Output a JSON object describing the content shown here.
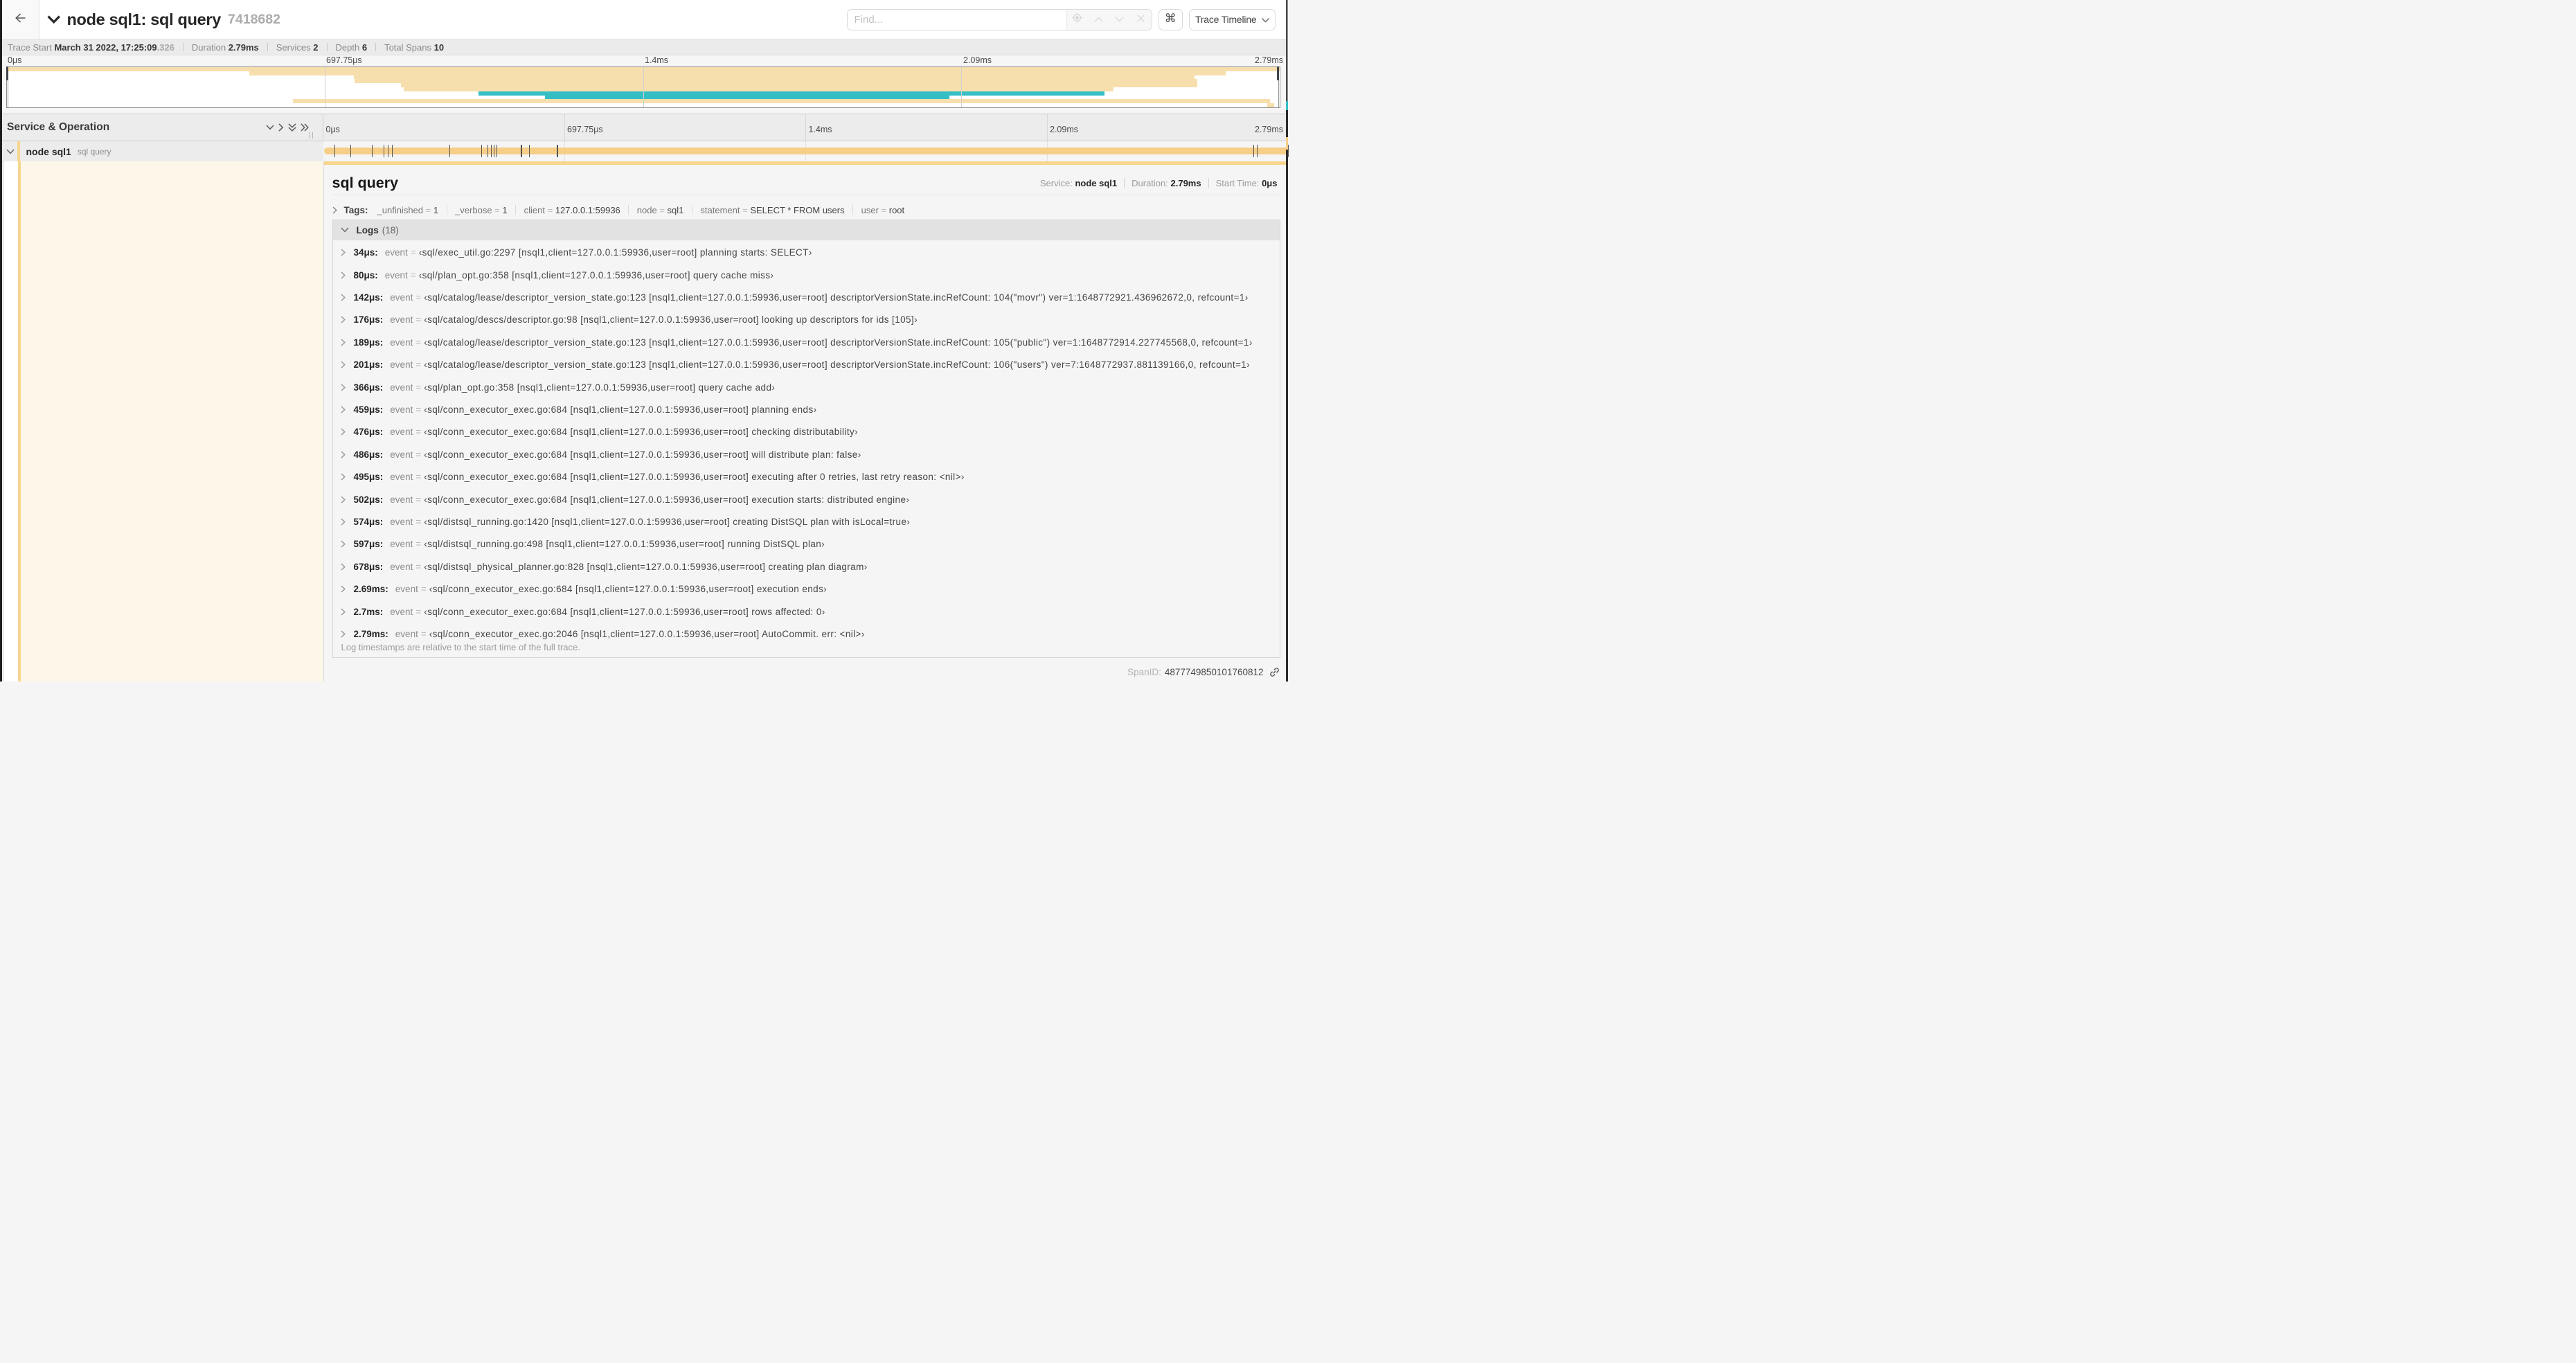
{
  "colors": {
    "tan_minimap": "#f7dfad",
    "teal_minimap": "#35bfc5",
    "tan_bar": "#f6ce87",
    "tan_strip": "#f6d68e",
    "cream": "#fdf7ea",
    "marker": "#555555"
  },
  "header": {
    "back_icon": "left-arrow",
    "collapse_icon": "chevron-down",
    "title": "node sql1: sql query",
    "trace_id": "7418682",
    "find_placeholder": "Find...",
    "find_icons": [
      "scope-icon",
      "chevron-up-icon",
      "chevron-down-icon",
      "clear-x-icon"
    ],
    "cmd_button": "⌘",
    "view_button": "Trace Timeline"
  },
  "summary": {
    "items": [
      {
        "label": "Trace Start",
        "value": "March 31 2022, 17:25:09",
        "sub": ".326"
      },
      {
        "label": "Duration",
        "value": "2.79ms"
      },
      {
        "label": "Services",
        "value": "2"
      },
      {
        "label": "Depth",
        "value": "6"
      },
      {
        "label": "Total Spans",
        "value": "10"
      }
    ]
  },
  "ruler": {
    "ticks": [
      {
        "label": "0μs",
        "pos": 0
      },
      {
        "label": "697.75μs",
        "pos": 0.25
      },
      {
        "label": "1.4ms",
        "pos": 0.5
      },
      {
        "label": "2.09ms",
        "pos": 0.75
      },
      {
        "label": "2.79ms",
        "pos": 1
      }
    ]
  },
  "minimap": {
    "spans": [
      {
        "start": 0,
        "end": 1,
        "color": "tan_minimap"
      },
      {
        "start": 0.1903,
        "end": 0.9578,
        "color": "tan_minimap"
      },
      {
        "start": 0.2724,
        "end": 0.9333,
        "color": "tan_minimap"
      },
      {
        "start": 0.2732,
        "end": 0.935,
        "color": "tan_minimap"
      },
      {
        "start": 0.3094,
        "end": 0.935,
        "color": "tan_minimap"
      },
      {
        "start": 0.3118,
        "end": 0.8694,
        "color": "tan_minimap"
      },
      {
        "start": 0.3703,
        "end": 0.8626,
        "color": "teal_minimap"
      },
      {
        "start": 0.4225,
        "end": 0.7403,
        "color": "teal_minimap"
      },
      {
        "start": 0.2248,
        "end": 0.9923,
        "color": "tan_minimap"
      },
      {
        "start": 0.9902,
        "end": 0.9956,
        "color": "tan_minimap"
      }
    ]
  },
  "timeline": {
    "column_title": "Service & Operation",
    "icons": [
      "chevron-down-icon",
      "chevron-right-icon",
      "double-chevron-down-icon",
      "double-chevron-right-icon"
    ]
  },
  "span_row": {
    "service": "node sql1",
    "operation": "sql query",
    "duration_us": 2790,
    "marker_times_us": [
      34,
      80,
      142,
      176,
      189,
      201,
      366,
      459,
      476,
      486,
      495,
      502,
      574,
      597,
      678,
      2690,
      2700,
      2790
    ]
  },
  "detail": {
    "title": "sql query",
    "meta": [
      {
        "label": "Service:",
        "value": "node sql1"
      },
      {
        "label": "Duration:",
        "value": "2.79ms"
      },
      {
        "label": "Start Time:",
        "value": "0μs"
      }
    ],
    "tags_label": "Tags:",
    "tags": [
      {
        "key": "_unfinished",
        "value": "1"
      },
      {
        "key": "_verbose",
        "value": "1"
      },
      {
        "key": "client",
        "value": "127.0.0.1:59936"
      },
      {
        "key": "node",
        "value": "sql1"
      },
      {
        "key": "statement",
        "value": "SELECT * FROM users"
      },
      {
        "key": "user",
        "value": "root"
      }
    ],
    "logs_label": "Logs",
    "logs_count": "(18)",
    "log_field": "event",
    "logs": [
      {
        "time": "34μs:",
        "value": "‹sql/exec_util.go:2297 [nsql1,client=127.0.0.1:59936,user=root] planning starts: SELECT›"
      },
      {
        "time": "80μs:",
        "value": "‹sql/plan_opt.go:358 [nsql1,client=127.0.0.1:59936,user=root] query cache miss›"
      },
      {
        "time": "142μs:",
        "value": "‹sql/catalog/lease/descriptor_version_state.go:123 [nsql1,client=127.0.0.1:59936,user=root] descriptorVersionState.incRefCount: 104(\"movr\") ver=1:1648772921.436962672,0, refcount=1›"
      },
      {
        "time": "176μs:",
        "value": "‹sql/catalog/descs/descriptor.go:98 [nsql1,client=127.0.0.1:59936,user=root] looking up descriptors for ids [105]›"
      },
      {
        "time": "189μs:",
        "value": "‹sql/catalog/lease/descriptor_version_state.go:123 [nsql1,client=127.0.0.1:59936,user=root] descriptorVersionState.incRefCount: 105(\"public\") ver=1:1648772914.227745568,0, refcount=1›"
      },
      {
        "time": "201μs:",
        "value": "‹sql/catalog/lease/descriptor_version_state.go:123 [nsql1,client=127.0.0.1:59936,user=root] descriptorVersionState.incRefCount: 106(\"users\") ver=7:1648772937.881139166,0, refcount=1›"
      },
      {
        "time": "366μs:",
        "value": "‹sql/plan_opt.go:358 [nsql1,client=127.0.0.1:59936,user=root] query cache add›"
      },
      {
        "time": "459μs:",
        "value": "‹sql/conn_executor_exec.go:684 [nsql1,client=127.0.0.1:59936,user=root] planning ends›"
      },
      {
        "time": "476μs:",
        "value": "‹sql/conn_executor_exec.go:684 [nsql1,client=127.0.0.1:59936,user=root] checking distributability›"
      },
      {
        "time": "486μs:",
        "value": "‹sql/conn_executor_exec.go:684 [nsql1,client=127.0.0.1:59936,user=root] will distribute plan: false›"
      },
      {
        "time": "495μs:",
        "value": "‹sql/conn_executor_exec.go:684 [nsql1,client=127.0.0.1:59936,user=root] executing after 0 retries, last retry reason: <nil>›"
      },
      {
        "time": "502μs:",
        "value": "‹sql/conn_executor_exec.go:684 [nsql1,client=127.0.0.1:59936,user=root] execution starts: distributed engine›"
      },
      {
        "time": "574μs:",
        "value": "‹sql/distsql_running.go:1420 [nsql1,client=127.0.0.1:59936,user=root] creating DistSQL plan with isLocal=true›"
      },
      {
        "time": "597μs:",
        "value": "‹sql/distsql_running.go:498 [nsql1,client=127.0.0.1:59936,user=root] running DistSQL plan›"
      },
      {
        "time": "678μs:",
        "value": "‹sql/distsql_physical_planner.go:828 [nsql1,client=127.0.0.1:59936,user=root] creating plan diagram›"
      },
      {
        "time": "2.69ms:",
        "value": "‹sql/conn_executor_exec.go:684 [nsql1,client=127.0.0.1:59936,user=root] execution ends›"
      },
      {
        "time": "2.7ms:",
        "value": "‹sql/conn_executor_exec.go:684 [nsql1,client=127.0.0.1:59936,user=root] rows affected: 0›"
      },
      {
        "time": "2.79ms:",
        "value": "‹sql/conn_executor_exec.go:2046 [nsql1,client=127.0.0.1:59936,user=root] AutoCommit. err: <nil>›"
      }
    ],
    "logs_note": "Log timestamps are relative to the start time of the full trace.",
    "span_id_label": "SpanID:",
    "span_id": "4877749850101760812",
    "link_icon": "link-icon"
  }
}
